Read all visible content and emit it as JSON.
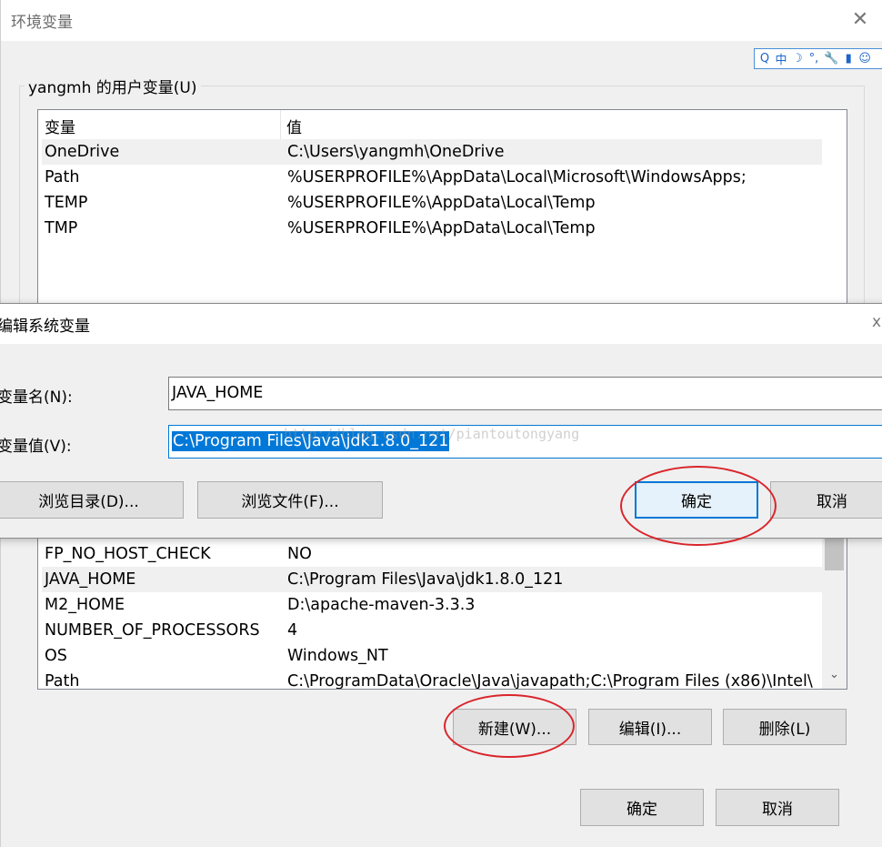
{
  "env_dialog": {
    "title": "环境变量",
    "close_glyph": "✕",
    "user_group_label": "yangmh 的用户变量(U)",
    "columns": {
      "name": "变量",
      "value": "值"
    },
    "user_vars": [
      {
        "name": "OneDrive",
        "value": "C:\\Users\\yangmh\\OneDrive"
      },
      {
        "name": "Path",
        "value": "%USERPROFILE%\\AppData\\Local\\Microsoft\\WindowsApps;"
      },
      {
        "name": "TEMP",
        "value": "%USERPROFILE%\\AppData\\Local\\Temp"
      },
      {
        "name": "TMP",
        "value": "%USERPROFILE%\\AppData\\Local\\Temp"
      }
    ],
    "system_vars": [
      {
        "name": "FP_NO_HOST_CHECK",
        "value": "NO"
      },
      {
        "name": "JAVA_HOME",
        "value": "C:\\Program Files\\Java\\jdk1.8.0_121"
      },
      {
        "name": "M2_HOME",
        "value": "D:\\apache-maven-3.3.3"
      },
      {
        "name": "NUMBER_OF_PROCESSORS",
        "value": "4"
      },
      {
        "name": "OS",
        "value": "Windows_NT"
      },
      {
        "name": "Path",
        "value": "C:\\ProgramData\\Oracle\\Java\\javapath;C:\\Program Files (x86)\\Intel\\"
      }
    ],
    "buttons": {
      "new": "新建(W)...",
      "edit": "编辑(I)...",
      "delete": "删除(L)",
      "ok": "确定",
      "cancel": "取消"
    },
    "scroll_down_glyph": "⌄"
  },
  "ime_toolbar": {
    "items": [
      "Q",
      "中",
      "☽",
      "°,",
      "🔧",
      "▮",
      "☺"
    ]
  },
  "edit_dialog": {
    "title": "编辑系统变量",
    "close_glyph": "x",
    "name_label": "变量名(N):",
    "value_label": "变量值(V):",
    "name_value": "JAVA_HOME",
    "value_value": "C:\\Program Files\\Java\\jdk1.8.0_121",
    "watermark": "http://blog.csdn.net/piantoutongyang",
    "buttons": {
      "browse_dir": "浏览目录(D)...",
      "browse_file": "浏览文件(F)...",
      "ok": "确定",
      "cancel": "取消"
    }
  },
  "colors": {
    "selection": "#0078d7",
    "annotation": "#d9252b"
  }
}
